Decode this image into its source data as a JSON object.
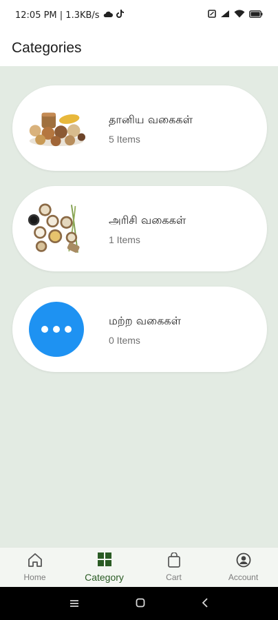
{
  "status_bar": {
    "time_and_speed": "12:05 PM | 1.3KB/s",
    "battery_level": "full"
  },
  "app_bar": {
    "title": "Categories"
  },
  "categories": [
    {
      "title": "தானிய வகைகள்",
      "count": "5 Items",
      "icon": "grains-image"
    },
    {
      "title": "அரிசி வகைகள்",
      "count": "1 Items",
      "icon": "rice-image"
    },
    {
      "title": "மற்ற வகைகள்",
      "count": "0 Items",
      "icon": "more-icon"
    }
  ],
  "bottom_nav": {
    "items": [
      {
        "label": "Home",
        "icon": "home-icon",
        "active": false
      },
      {
        "label": "Category",
        "icon": "category-grid-icon",
        "active": true
      },
      {
        "label": "Cart",
        "icon": "cart-bag-icon",
        "active": false
      },
      {
        "label": "Account",
        "icon": "account-icon",
        "active": false
      }
    ]
  },
  "colors": {
    "content_background": "#e3ebe3",
    "accent_green": "#2a5b24",
    "more_circle_blue": "#1e92f2"
  }
}
